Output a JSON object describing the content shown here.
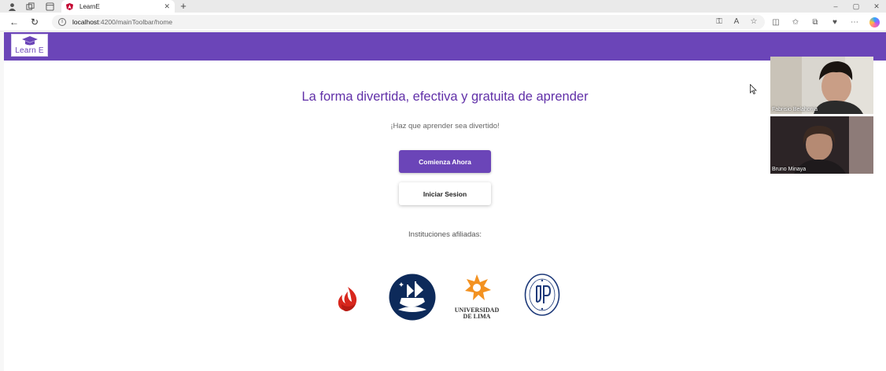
{
  "browser": {
    "tab": {
      "title": "LearnE",
      "close": "✕"
    },
    "new_tab": "+",
    "window_controls": [
      "–",
      "▢",
      "✕"
    ],
    "nav": {
      "back": "←",
      "refresh": "↻"
    },
    "url": {
      "host": "localhost",
      "path": ":4200/mainToolbar/home"
    },
    "url_icons": [
      "key-icon",
      "read-aloud-icon",
      "favorite-star-icon"
    ],
    "toolbar_icons": [
      "split-screen-icon",
      "favorites-icon",
      "collections-icon",
      "extensions-icon",
      "more-menu-icon",
      "copilot-icon"
    ]
  },
  "app": {
    "brand_color": "#6b45b8",
    "logo_text": "Learn E",
    "headline": "La forma divertida, efectiva y gratuita de aprender",
    "subtitle": "¡Haz que aprender sea divertido!",
    "primary_button": "Comienza Ahora",
    "secondary_button": "Iniciar Sesion",
    "affiliates_label": "Instituciones afiliadas:",
    "institutions": [
      {
        "icon": "upc-logo-icon"
      },
      {
        "icon": "pucp-logo-icon"
      },
      {
        "icon": "ulima-logo-icon",
        "text_line1": "UNIVERSIDAD",
        "text_line2": "DE LIMA"
      },
      {
        "icon": "up-logo-icon"
      }
    ]
  },
  "video_call": {
    "participants": [
      {
        "name": "Fabrisio Belahonia"
      },
      {
        "name": "Bruno Minaya"
      }
    ]
  }
}
